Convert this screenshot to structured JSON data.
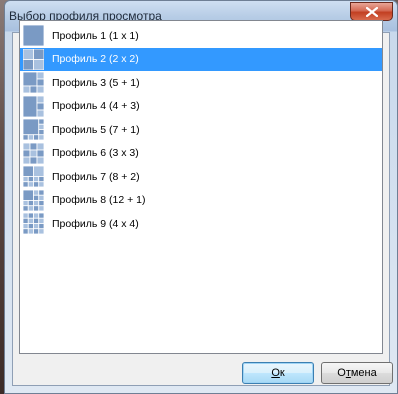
{
  "window": {
    "title": "Выбор профиля просмотра",
    "close_icon": "close-icon"
  },
  "profiles": [
    {
      "label": "Профиль 1 (1 x 1)",
      "grid": "1x1",
      "selected": false
    },
    {
      "label": "Профиль 2 (2 x 2)",
      "grid": "2x2",
      "selected": true
    },
    {
      "label": "Профиль 3 (5 + 1)",
      "grid": "5+1",
      "selected": false
    },
    {
      "label": "Профиль 4 (4 + 3)",
      "grid": "4+3",
      "selected": false
    },
    {
      "label": "Профиль 5 (7 + 1)",
      "grid": "7+1",
      "selected": false
    },
    {
      "label": "Профиль 6 (3 x 3)",
      "grid": "3x3",
      "selected": false
    },
    {
      "label": "Профиль 7 (8 + 2)",
      "grid": "8+2",
      "selected": false
    },
    {
      "label": "Профиль 8 (12 + 1)",
      "grid": "12+1",
      "selected": false
    },
    {
      "label": "Профиль 9 (4 x 4)",
      "grid": "4x4",
      "selected": false
    }
  ],
  "buttons": {
    "ok_accel": "О",
    "ok_rest": "к",
    "cancel_pre": "О",
    "cancel_accel": "т",
    "cancel_rest": "мена"
  },
  "colors": {
    "selection": "#3399ff",
    "tile": "#7a9ac4",
    "tile_light": "#a9c1df"
  }
}
